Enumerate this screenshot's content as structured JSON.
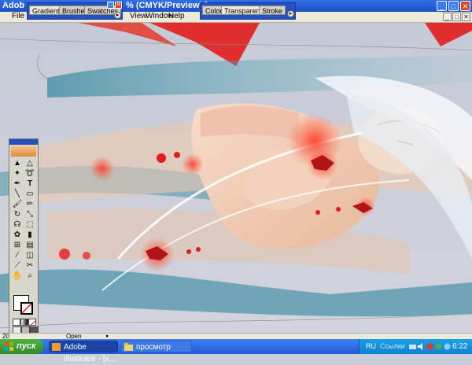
{
  "window": {
    "app_title": "Adob",
    "title_rest": "% (CMYK/Preview) ]",
    "minimize": "_",
    "maximize": "□",
    "close": "✕"
  },
  "menu": {
    "items": [
      "File",
      "View",
      "Window",
      "Help"
    ],
    "doc_min": "_",
    "doc_max": "□",
    "doc_close": "✕"
  },
  "palettes": {
    "gradient_group": {
      "tabs": [
        "Gradient",
        "Brushes",
        "Swatches"
      ],
      "active_tab": "Gradient"
    },
    "transparency_group": {
      "tabs": [
        "Color",
        "Transparency",
        "Stroke"
      ],
      "active_tab": "Transparency"
    },
    "menu_glyph": "▸"
  },
  "toolbox": {
    "tools": [
      "selection-tool",
      "direct-selection-tool",
      "magic-wand-tool",
      "lasso-tool",
      "pen-tool",
      "type-tool",
      "line-tool",
      "rectangle-tool",
      "paintbrush-tool",
      "pencil-tool",
      "rotate-tool",
      "scale-tool",
      "warp-tool",
      "free-transform-tool",
      "symbol-sprayer-tool",
      "graph-tool",
      "mesh-tool",
      "gradient-tool",
      "eyedropper-tool",
      "blend-tool",
      "slice-tool",
      "scissors-tool",
      "hand-tool",
      "zoom-tool"
    ],
    "type_tool_glyph": "T"
  },
  "statusbar": {
    "zoom": "20",
    "status": "Open"
  },
  "taskbar": {
    "start_label": "пуск",
    "tasks": [
      {
        "label": "Adobe Illustrator - [x...",
        "active": true
      },
      {
        "label": "просмотр",
        "active": false
      }
    ],
    "language": "RU",
    "tray_word": "Ссылки",
    "clock": "6:22"
  },
  "colors": {
    "title_blue": "#1d4fc7",
    "taskbar_blue": "#2358d6",
    "start_green": "#2f8a26",
    "accent_red": "#e21d1d",
    "artwork_teal": "#2a8aa0"
  }
}
